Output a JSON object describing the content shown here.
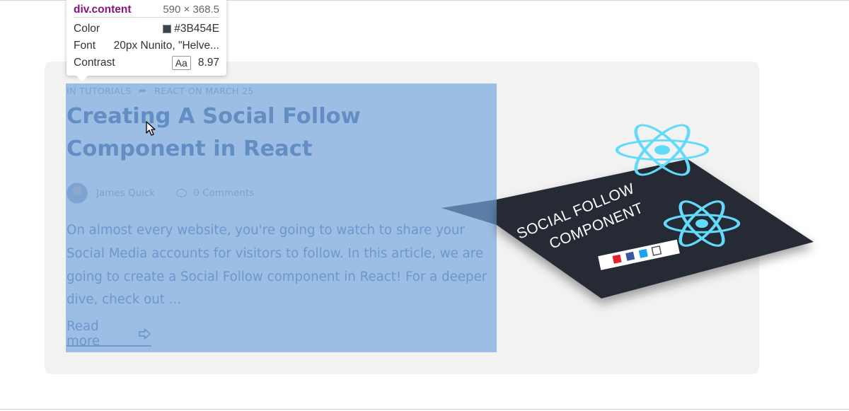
{
  "post": {
    "category": "IN TUTORIALS",
    "tag": "REACT ON MARCH 25",
    "title": "Creating A Social Follow Component in React",
    "author": "James Quick",
    "comments": "0 Comments",
    "excerpt": "On almost every website, you're going to watch to share your Social Media accounts for visitors to follow. In this article, we are going to create a Social Follow component in React! For a deeper dive, check out ...",
    "read_more": "Read more"
  },
  "image": {
    "line1": "SOCIAL FOLLOW",
    "line2": "COMPONENT"
  },
  "inspector": {
    "element": "div.content",
    "size": "590 × 368.5",
    "color_label": "Color",
    "color_value": "#3B454E",
    "font_label": "Font",
    "font_value": "20px Nunito, \"Helve...",
    "contrast_label": "Contrast",
    "contrast_aa": "Aa",
    "contrast_value": "8.97"
  },
  "colors": {
    "text": "#3B454E",
    "highlight": "#6fa1dc",
    "react": "#61dafb",
    "card": "#1f2430"
  },
  "icons": [
    "tag-icon",
    "comment-icon",
    "arrow-right-icon",
    "react-logo-icon",
    "cursor-icon"
  ]
}
